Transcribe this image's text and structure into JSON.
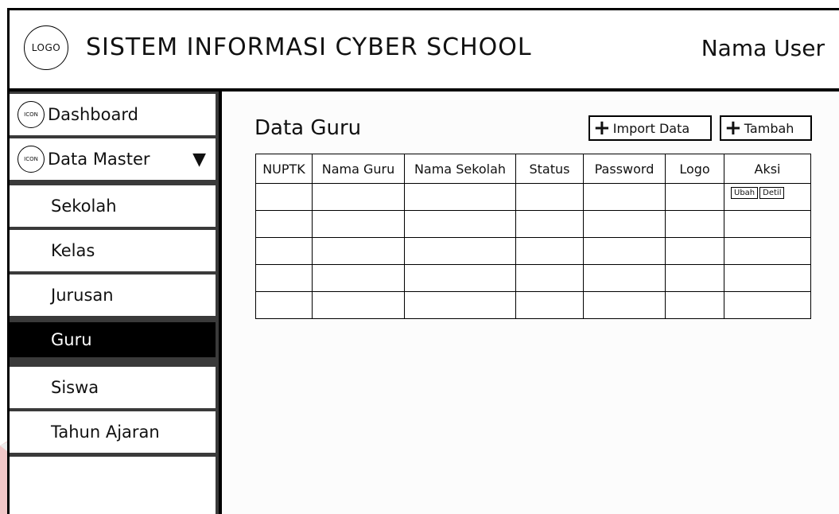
{
  "header": {
    "logo_text": "LOGO",
    "app_title": "SISTEM INFORMASI CYBER SCHOOL",
    "user_name": "Nama User"
  },
  "sidebar": {
    "icon_text": "ICON",
    "items": [
      {
        "label": "Dashboard"
      },
      {
        "label": "Data Master",
        "caret": "▼"
      },
      {
        "label": "Sekolah"
      },
      {
        "label": "Kelas"
      },
      {
        "label": "Jurusan"
      },
      {
        "label": "Guru",
        "active": true
      },
      {
        "label": "Siswa"
      },
      {
        "label": "Tahun Ajaran"
      }
    ]
  },
  "main": {
    "title": "Data Guru",
    "import_label": "Import Data",
    "add_label": "Tambah",
    "plus_icon": "+",
    "table": {
      "columns": [
        "NUPTK",
        "Nama Guru",
        "Nama Sekolah",
        "Status",
        "Password",
        "Logo",
        "Aksi"
      ],
      "row_count": 5,
      "row_actions": [
        "Ubah",
        "Detil"
      ]
    }
  },
  "colors": {
    "active_bg": "#000000",
    "sidebar_bg": "#3a3a3a"
  }
}
